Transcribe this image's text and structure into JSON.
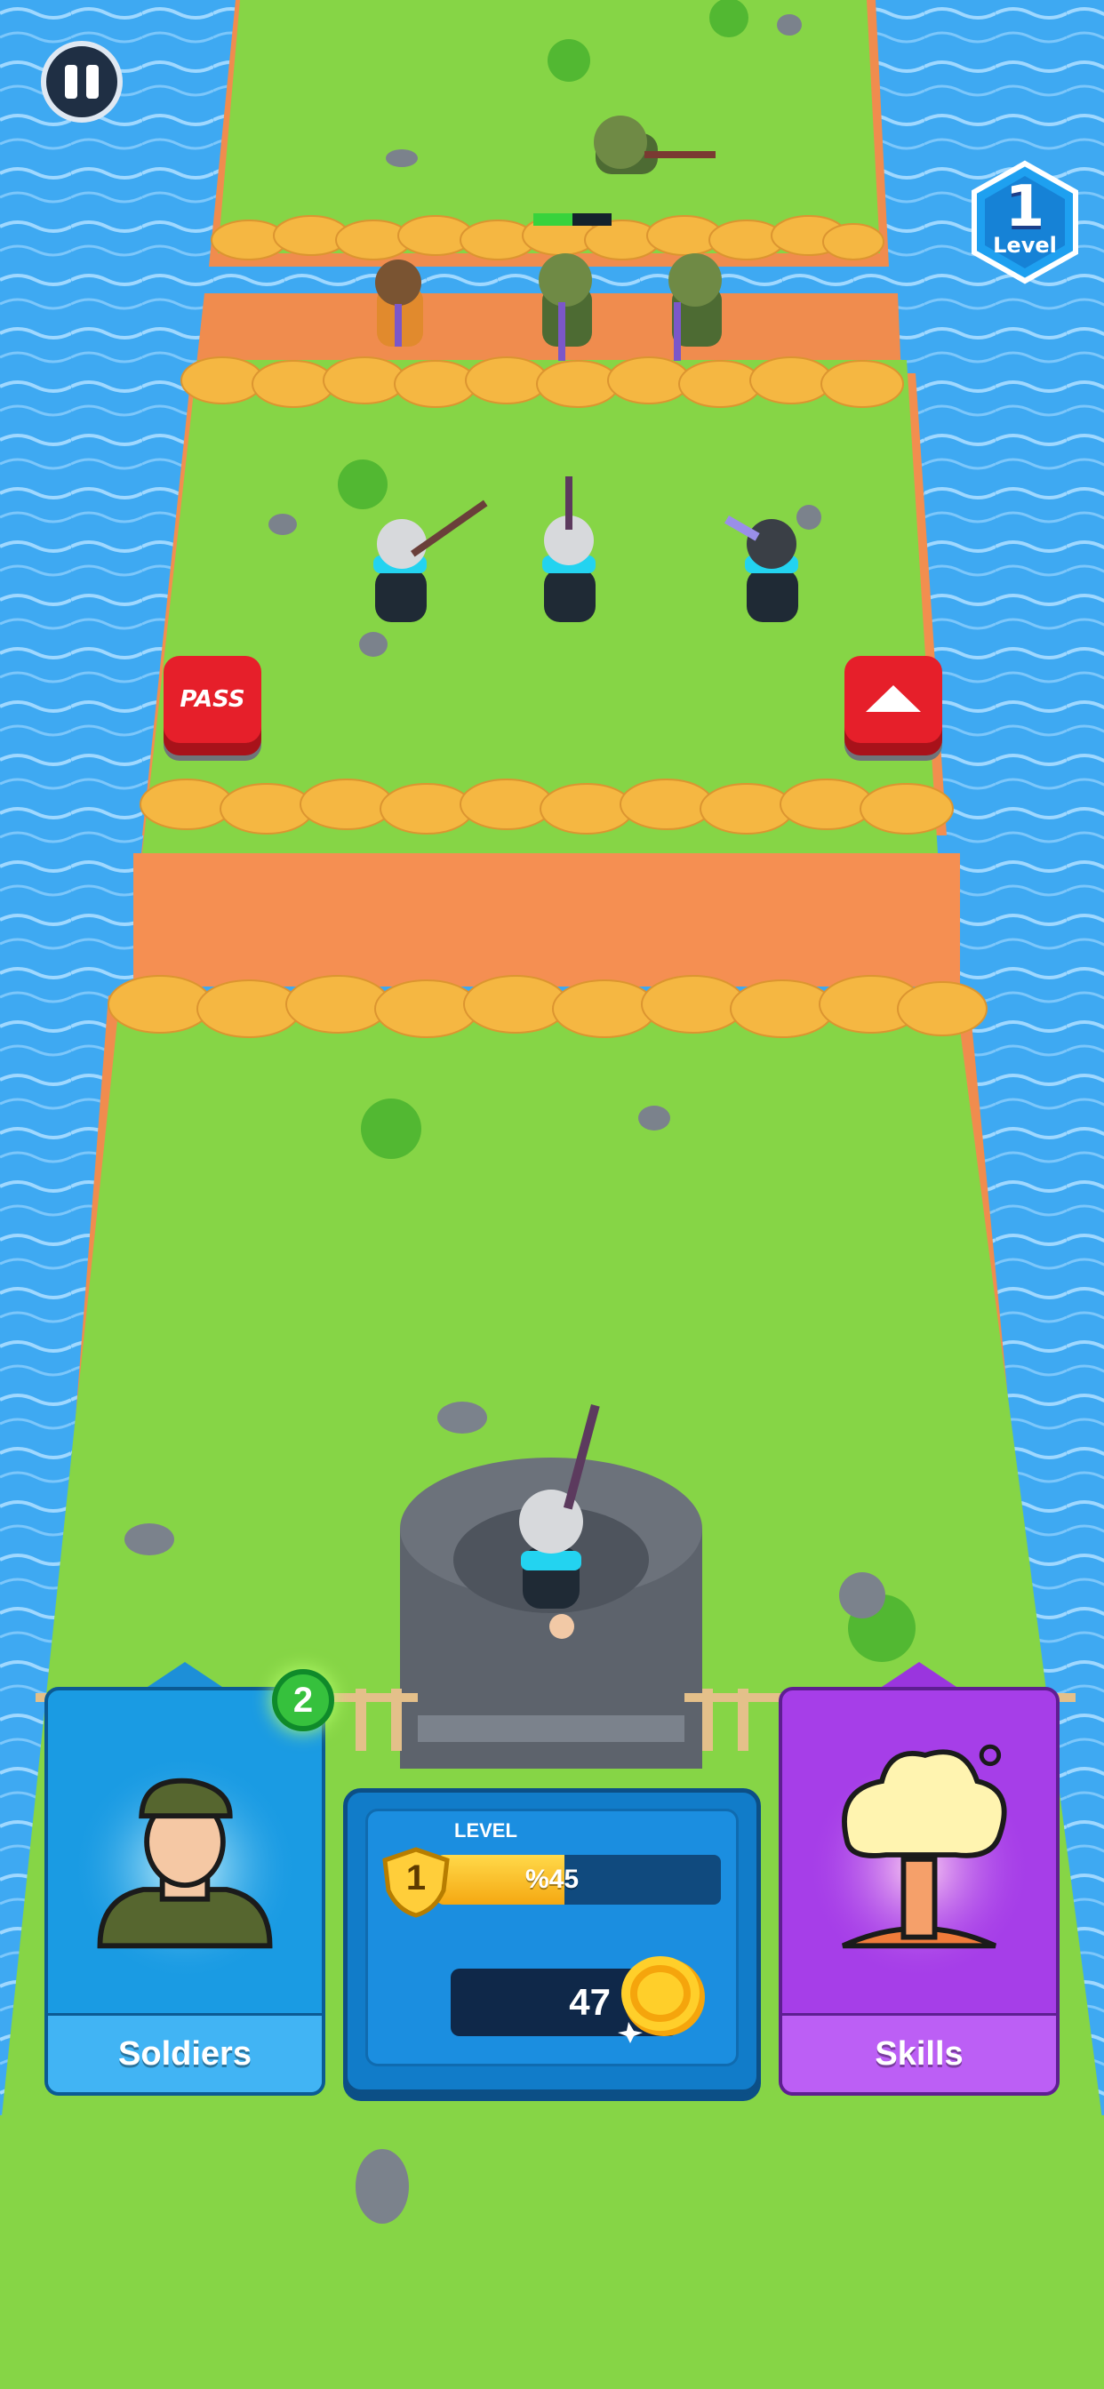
{
  "hud": {
    "level_number": "1",
    "level_label": "Level"
  },
  "buttons": {
    "pass_label": "PASS",
    "up_icon": "chevron-up-icon",
    "pause_icon": "pause-icon"
  },
  "cards": {
    "soldiers": {
      "label": "Soldiers",
      "badge": "2",
      "icon": "soldier-icon"
    },
    "skills": {
      "label": "Skills",
      "icon": "mushroom-cloud-icon"
    }
  },
  "level_panel": {
    "label": "LEVEL",
    "level_number": "1",
    "progress_text": "%45",
    "progress_fraction": 0.45,
    "coins": "47",
    "coin_icon": "gold-coin-icon"
  },
  "scene": {
    "enemy_health_fraction": 0.5
  }
}
